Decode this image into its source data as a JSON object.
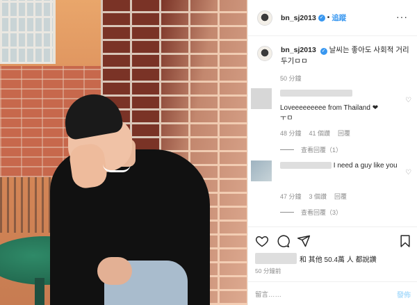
{
  "post": {
    "username": "bn_sj2013",
    "verified_mark": "✓",
    "separator": "•",
    "follow_label": "追蹤",
    "more_label": "···",
    "caption_username": "bn_sj2013",
    "caption_text": "날씨는 좋아도 사회적 거리두기ㅁㅁ",
    "caption_time": "50 分鐘"
  },
  "comments": [
    {
      "text": "Loveeeeeeeee from Thailand ❤",
      "text2": "ㅜㅁ",
      "time": "48 分鐘",
      "likes": "41 個讚",
      "reply_label": "回覆",
      "view_replies": "查看回覆（1）"
    },
    {
      "text": "I need a guy like you",
      "time": "47 分鐘",
      "likes": "3 個讚",
      "reply_label": "回覆",
      "view_replies": "查看回覆（3）"
    }
  ],
  "footer": {
    "likes_text": "和 其他 50.4萬 人 都說讚",
    "post_time": "50 分鐘前",
    "comment_placeholder": "留言……",
    "post_button": "發佈"
  },
  "icons": {
    "heart": "heart-icon",
    "comment": "comment-icon",
    "share": "share-icon",
    "bookmark": "bookmark-icon"
  },
  "colors": {
    "accent": "#3897f0",
    "muted": "#8e8e8e",
    "post_disabled": "#b2dffc"
  }
}
